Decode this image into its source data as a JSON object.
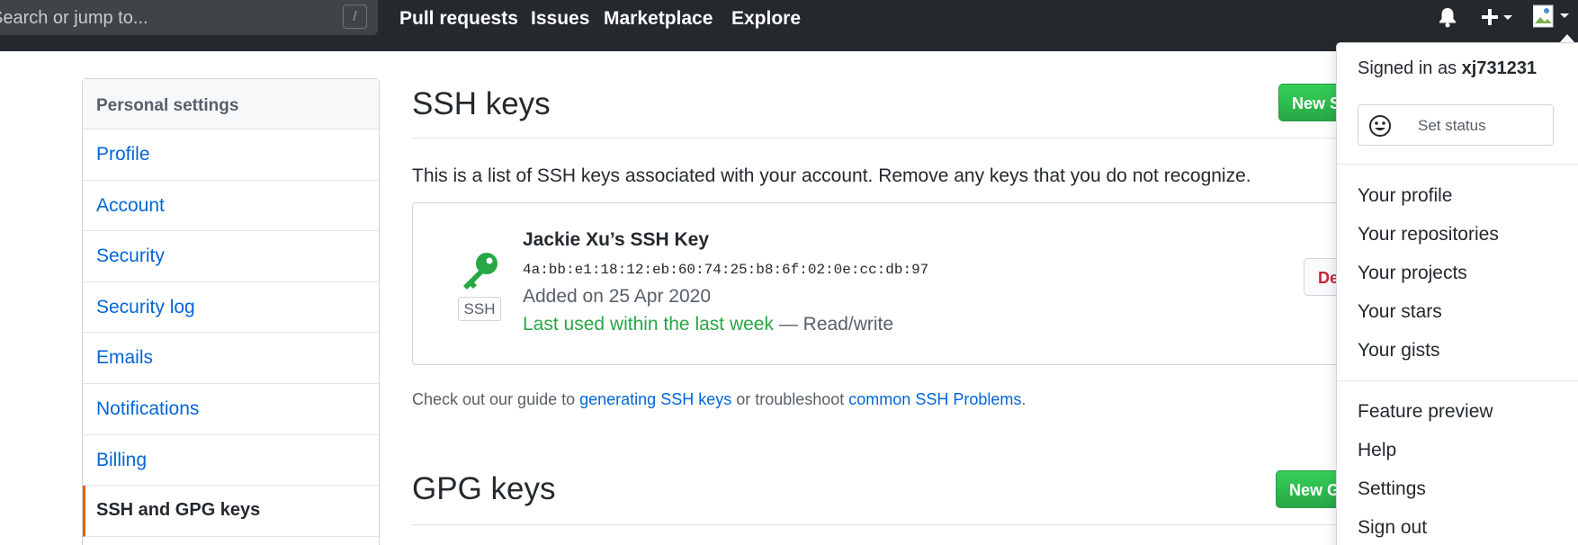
{
  "header": {
    "search_placeholder": "Search or jump to...",
    "search_shortcut": "/",
    "nav": [
      "Pull requests",
      "Issues",
      "Marketplace",
      "Explore"
    ],
    "icons": [
      "bell-icon",
      "plus-icon",
      "avatar"
    ]
  },
  "sidebar": {
    "heading": "Personal settings",
    "items": [
      {
        "label": "Profile"
      },
      {
        "label": "Account"
      },
      {
        "label": "Security"
      },
      {
        "label": "Security log"
      },
      {
        "label": "Emails"
      },
      {
        "label": "Notifications"
      },
      {
        "label": "Billing"
      },
      {
        "label": "SSH and GPG keys",
        "selected": true
      }
    ]
  },
  "ssh": {
    "title": "SSH keys",
    "new_button": "New SSH key",
    "intro": "This is a list of SSH keys associated with your account. Remove any keys that you do not recognize.",
    "key": {
      "badge": "SSH",
      "name": "Jackie Xu’s SSH Key",
      "fingerprint": "4a:bb:e1:18:12:eb:60:74:25:b8:6f:02:0e:cc:db:97",
      "added": "Added on 25 Apr 2020",
      "last_used": "Last used within the last week",
      "access": " — Read/write",
      "delete_button": "Delete"
    },
    "guide": {
      "prefix": "Check out our guide to ",
      "link1": "generating SSH keys",
      "middle": " or troubleshoot ",
      "link2": "common SSH Problems",
      "suffix": "."
    }
  },
  "gpg": {
    "title": "GPG keys",
    "new_button": "New GPG key"
  },
  "dropdown": {
    "signed_in_prefix": "Signed in as ",
    "username": "xj731231",
    "set_status": "Set status",
    "items_group1": [
      "Your profile",
      "Your repositories",
      "Your projects",
      "Your stars",
      "Your gists"
    ],
    "items_group2": [
      "Feature preview",
      "Help",
      "Settings",
      "Sign out"
    ]
  },
  "colors": {
    "header_bg": "#24292e",
    "link": "#0366d6",
    "green": "#28a745",
    "selected_accent": "#e36209",
    "danger": "#cb2431"
  }
}
